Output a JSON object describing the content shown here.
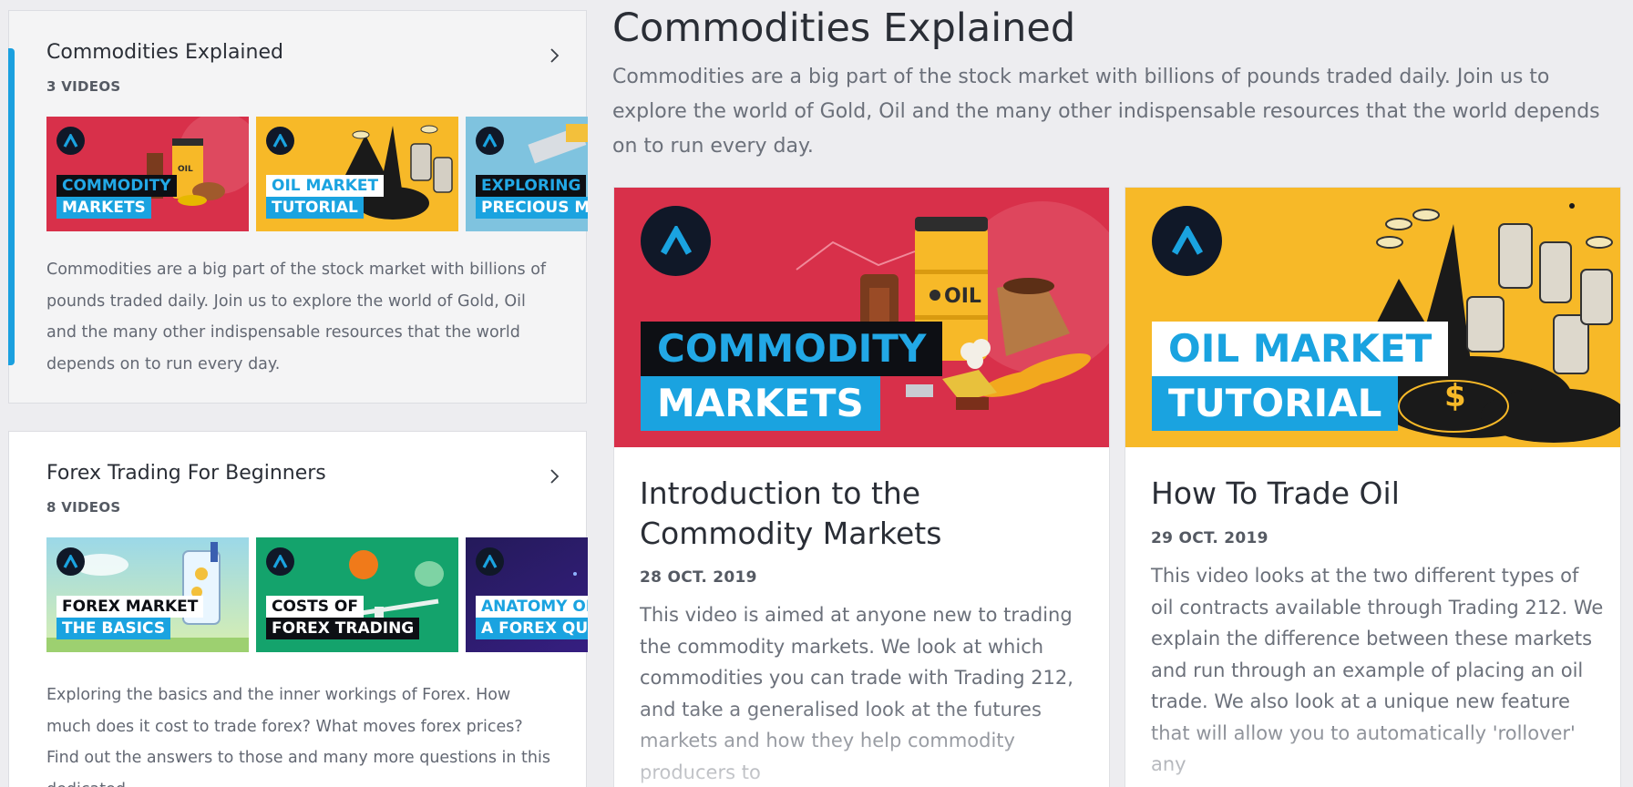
{
  "playlists": [
    {
      "title": "Commodities Explained",
      "count": "3 VIDEOS",
      "description": "Commodities are a big part of the stock market with billions of pounds traded daily. Join us to explore the world of Gold, Oil and the many other indispensable resources that the world depends on to run every day.",
      "thumbs": [
        {
          "line1": "COMMODITY",
          "line2": "MARKETS"
        },
        {
          "line1": "OIL MARKET",
          "line2": "TUTORIAL"
        },
        {
          "line1": "EXPLORING",
          "line2": "PRECIOUS METALS"
        }
      ]
    },
    {
      "title": "Forex Trading For Beginners",
      "count": "8 VIDEOS",
      "description": "Exploring the basics and the inner workings of Forex. How much does it cost to trade forex? What moves forex prices? Find out the answers to those and many more questions in this dedicated",
      "thumbs": [
        {
          "line1": "FOREX MARKET",
          "line2": "THE BASICS"
        },
        {
          "line1": "COSTS OF",
          "line2": "FOREX TRADING"
        },
        {
          "line1": "ANATOMY OF",
          "line2": "A FOREX QUOTE"
        }
      ]
    }
  ],
  "section": {
    "title": "Commodities Explained",
    "description": "Commodities are a big part of the stock market with billions of pounds traded daily. Join us to explore the world of Gold, Oil and the many other indispensable resources that the world depends on to run every day."
  },
  "videos": [
    {
      "hero_line1": "COMMODITY",
      "hero_line2": "MARKETS",
      "title": "Introduction to the Commodity Markets",
      "date": "28 OCT. 2019",
      "description": "This video is aimed at anyone new to trading the commodity markets. We look at which commodities you can trade with Trading 212, and take a generalised look at the futures markets and how they help commodity producers to"
    },
    {
      "hero_line1": "OIL MARKET",
      "hero_line2": "TUTORIAL",
      "title": "How To Trade Oil",
      "date": "29 OCT. 2019",
      "description": "This video looks at the two different types of oil contracts available through Trading 212. We explain the difference between these markets and run through an example of placing an oil trade. We also look at a unique new feature that will allow you to automatically 'rollover' any"
    }
  ],
  "hero_labels": {
    "oil_barrel": "OIL"
  },
  "colors": {
    "accent": "#1ba0df",
    "commodity_red": "#d8304a",
    "oil_yellow": "#f7b928",
    "logo_dark": "#101828"
  },
  "icons": [
    "chevron-right-icon",
    "brand-logo-icon",
    "oil-barrel-icon",
    "gold-coins-icon"
  ]
}
